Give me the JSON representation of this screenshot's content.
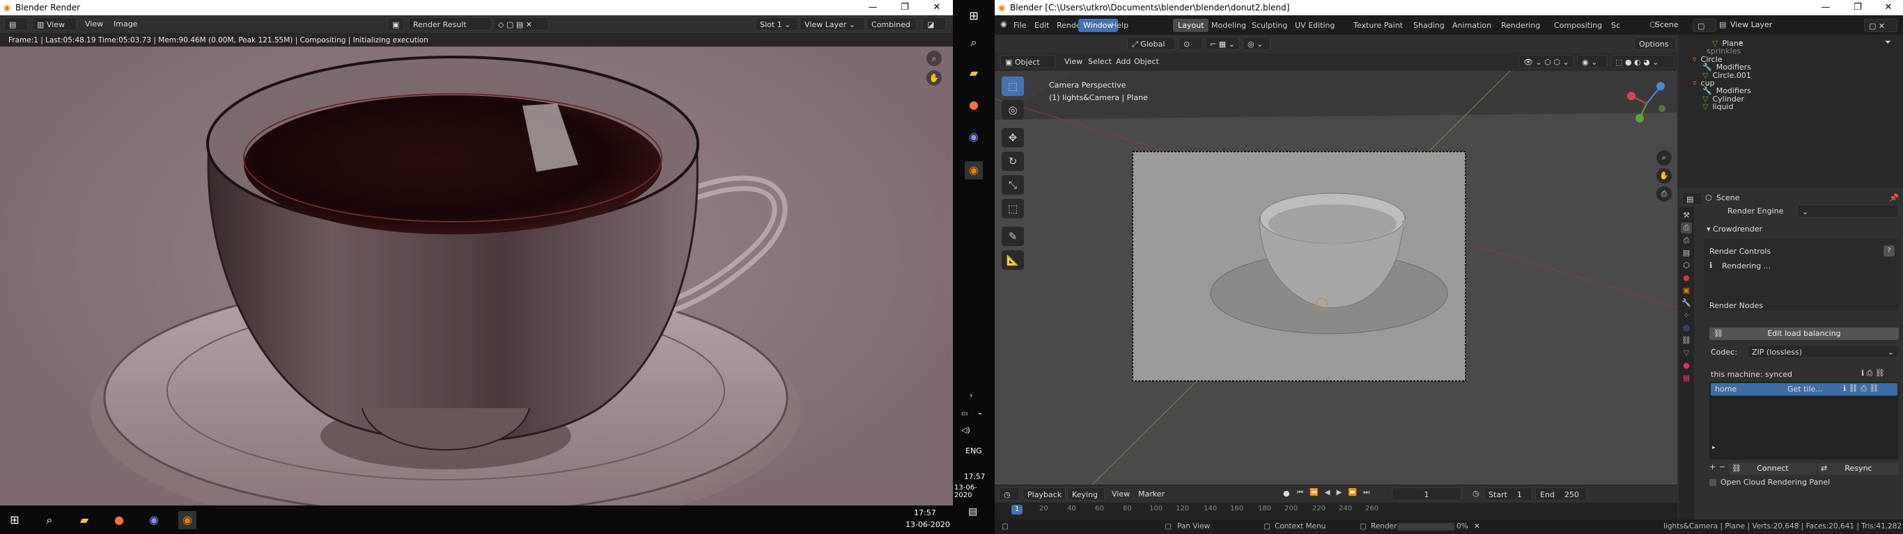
{
  "render_window": {
    "title": "Blender Render",
    "menus": [
      "View",
      "View",
      "Image"
    ],
    "image_name": "Render Result",
    "slot": "Slot 1",
    "view_layer": "View Layer",
    "pass": "Combined",
    "info_bar": "Frame:1 | Last:05:48.19 Time:05:03.73 | Mem:90.46M (0.00M, Peak 121.55M) | Compositing | Initializing execution"
  },
  "taskbar_left": {
    "time": "17:57",
    "date": "13-06-2020",
    "icons": [
      "windows-icon",
      "search-icon",
      "file-explorer-icon",
      "firefox-icon",
      "app-icon",
      "blender-icon"
    ]
  },
  "taskbar_right": {
    "time": "17:57",
    "date": "13-06-2020",
    "lang": "ENG"
  },
  "blender": {
    "title": "Blender [C:\\Users\\utkro\\Documents\\blender\\blender\\donut2.blend]",
    "menus": [
      "File",
      "Edit",
      "Render",
      "Window",
      "Help"
    ],
    "workspaces": [
      "Layout",
      "Modeling",
      "Sculpting",
      "UV Editing",
      "Texture Paint",
      "Shading",
      "Animation",
      "Rendering",
      "Compositing",
      "Sc"
    ],
    "active_workspace": "Layout",
    "scene": "Scene",
    "view_layer": "View Layer",
    "transform_orientation": "Global",
    "options": "Options",
    "mode": "Object Mode",
    "viewport_menus": [
      "View",
      "Select",
      "Add",
      "Object"
    ],
    "overlay_title": "Camera Perspective",
    "overlay_sub": "(1) lights&Camera | Plane"
  },
  "outliner": {
    "items": [
      {
        "label": "Plane",
        "indent": 2,
        "icon": "mesh-icon"
      },
      {
        "label": "sprinkles",
        "indent": 1,
        "icon": "none"
      },
      {
        "label": "Circle",
        "indent": 0,
        "icon": "object-icon"
      },
      {
        "label": "Modifiers",
        "indent": 1,
        "icon": "wrench-icon"
      },
      {
        "label": "Circle.001",
        "indent": 1,
        "icon": "mesh-icon"
      },
      {
        "label": "cup",
        "indent": 0,
        "icon": "object-icon"
      },
      {
        "label": "Modifiers",
        "indent": 1,
        "icon": "wrench-icon"
      },
      {
        "label": "Cylinder",
        "indent": 1,
        "icon": "mesh-icon"
      },
      {
        "label": "liquid",
        "indent": 1,
        "icon": "mesh-icon"
      }
    ]
  },
  "properties": {
    "breadcrumb": "Scene",
    "render_engine_label": "Render Engine",
    "panel": "Crowdrender",
    "render_controls": "Render Controls",
    "rendering_status": "Rendering ...",
    "render_nodes": "Render Nodes",
    "edit_load_balancing": "Edit load balancing",
    "codec_label": "Codec:",
    "codec_value": "ZIP (lossless)",
    "this_machine_label": "this machine:",
    "this_machine_status": "synced",
    "node_name": "home",
    "node_action": "Get tile...",
    "connect": "Connect",
    "resync": "Resync",
    "open_cloud": "Open Cloud Rendering Panel"
  },
  "timeline": {
    "menus": [
      "Playback",
      "Keying",
      "View",
      "Marker"
    ],
    "current_frame": "1",
    "start_label": "Start",
    "start": "1",
    "end_label": "End",
    "end": "250",
    "ticks": [
      "1",
      "20",
      "40",
      "60",
      "80",
      "100",
      "120",
      "140",
      "160",
      "180",
      "200",
      "220",
      "240",
      "260"
    ]
  },
  "statusbar": {
    "pan_view": "Pan View",
    "context_menu": "Context Menu",
    "render_label": "Render",
    "render_progress": "0%",
    "render_progress_fraction": 0.0,
    "stats": "lights&Camera | Plane | Verts:20,648 | Faces:20,641 | Tris:41,282 |"
  }
}
